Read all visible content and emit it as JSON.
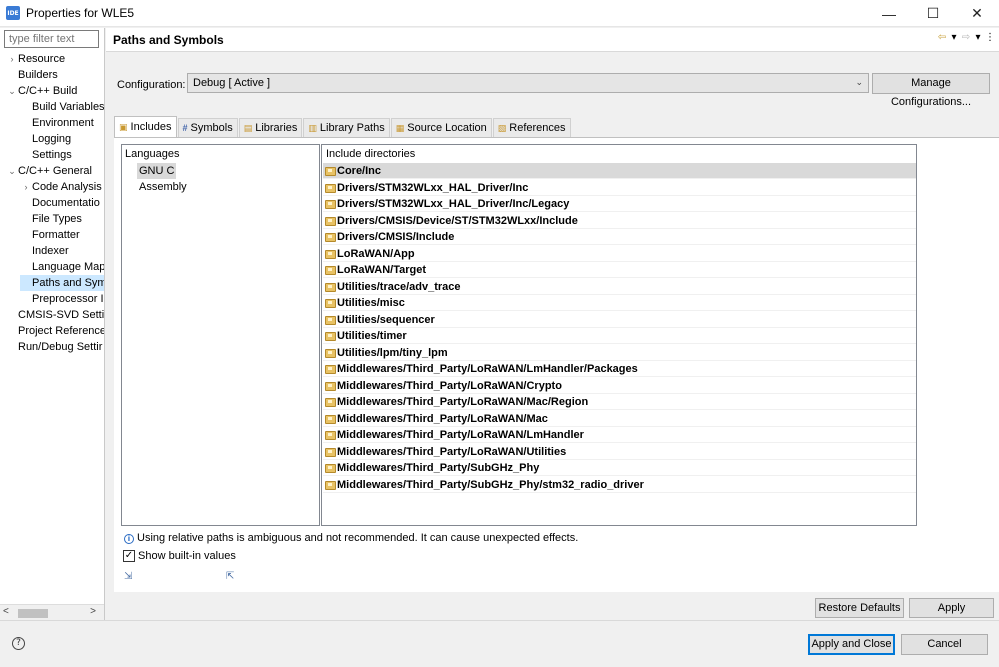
{
  "window": {
    "app_icon": "IDE",
    "title": "Properties for WLE5",
    "minimize": "—",
    "maximize": "☐",
    "close": "✕"
  },
  "sidebar": {
    "filter_placeholder": "type filter text",
    "items": [
      {
        "label": "Resource",
        "chevron": "›",
        "indent": 0
      },
      {
        "label": "Builders",
        "chevron": "",
        "indent": 0
      },
      {
        "label": "C/C++ Build",
        "chevron": "⌄",
        "indent": 0
      },
      {
        "label": "Build Variables",
        "chevron": "",
        "indent": 1
      },
      {
        "label": "Environment",
        "chevron": "",
        "indent": 1
      },
      {
        "label": "Logging",
        "chevron": "",
        "indent": 1
      },
      {
        "label": "Settings",
        "chevron": "",
        "indent": 1
      },
      {
        "label": "C/C++ General",
        "chevron": "⌄",
        "indent": 0
      },
      {
        "label": "Code Analysis",
        "chevron": "›",
        "indent": 1
      },
      {
        "label": "Documentatio",
        "chevron": "",
        "indent": 1
      },
      {
        "label": "File Types",
        "chevron": "",
        "indent": 1
      },
      {
        "label": "Formatter",
        "chevron": "",
        "indent": 1
      },
      {
        "label": "Indexer",
        "chevron": "",
        "indent": 1
      },
      {
        "label": "Language Map",
        "chevron": "",
        "indent": 1
      },
      {
        "label": "Paths and Sym",
        "chevron": "",
        "indent": 1,
        "selected": true
      },
      {
        "label": "Preprocessor I",
        "chevron": "",
        "indent": 1
      },
      {
        "label": "CMSIS-SVD Settir",
        "chevron": "",
        "indent": 0
      },
      {
        "label": "Project Reference:",
        "chevron": "",
        "indent": 0
      },
      {
        "label": "Run/Debug Settir",
        "chevron": "",
        "indent": 0
      }
    ]
  },
  "page": {
    "title": "Paths and Symbols"
  },
  "config": {
    "label": "Configuration:",
    "value": "Debug  [ Active ]",
    "manage_label": "Manage Configurations..."
  },
  "tabs": [
    {
      "label": "Includes",
      "icon": "includes-icon",
      "active": true
    },
    {
      "label": "Symbols",
      "icon": "symbols-icon"
    },
    {
      "label": "Libraries",
      "icon": "libraries-icon"
    },
    {
      "label": "Library Paths",
      "icon": "library-paths-icon"
    },
    {
      "label": "Source Location",
      "icon": "source-location-icon"
    },
    {
      "label": "References",
      "icon": "references-icon"
    }
  ],
  "languages": {
    "header": "Languages",
    "items": [
      "GNU C",
      "Assembly"
    ]
  },
  "includes": {
    "header": "Include directories",
    "items": [
      "Core/Inc",
      "Drivers/STM32WLxx_HAL_Driver/Inc",
      "Drivers/STM32WLxx_HAL_Driver/Inc/Legacy",
      "Drivers/CMSIS/Device/ST/STM32WLxx/Include",
      "Drivers/CMSIS/Include",
      "LoRaWAN/App",
      "LoRaWAN/Target",
      "Utilities/trace/adv_trace",
      "Utilities/misc",
      "Utilities/sequencer",
      "Utilities/timer",
      "Utilities/lpm/tiny_lpm",
      "Middlewares/Third_Party/LoRaWAN/LmHandler/Packages",
      "Middlewares/Third_Party/LoRaWAN/Crypto",
      "Middlewares/Third_Party/LoRaWAN/Mac/Region",
      "Middlewares/Third_Party/LoRaWAN/Mac",
      "Middlewares/Third_Party/LoRaWAN/LmHandler",
      "Middlewares/Third_Party/LoRaWAN/Utilities",
      "Middlewares/Third_Party/SubGHz_Phy",
      "Middlewares/Third_Party/SubGHz_Phy/stm32_radio_driver"
    ]
  },
  "info_text": "Using relative paths is ambiguous and not recommended. It can cause unexpected effects.",
  "show_builtin": {
    "label": "Show built-in values",
    "checked": true,
    "mark": "✓"
  },
  "buttons": {
    "restore_defaults": "Restore Defaults",
    "apply": "Apply",
    "apply_and_close": "Apply and Close",
    "cancel": "Cancel",
    "help": "?"
  },
  "colors": {
    "selection": "#cce8ff",
    "default_button_border": "#0078d7",
    "folder": "#e8c264"
  }
}
